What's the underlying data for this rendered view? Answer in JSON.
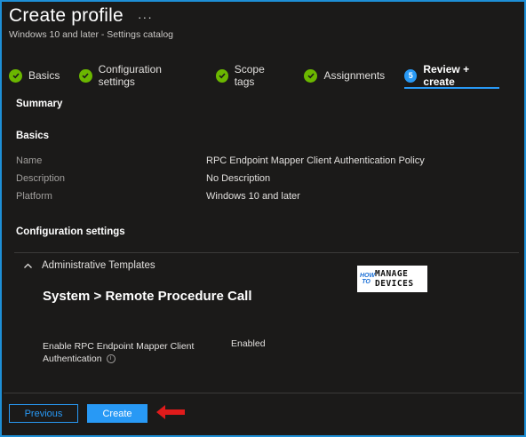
{
  "header": {
    "title": "Create profile",
    "more_label": "···",
    "subtitle": "Windows 10 and later - Settings catalog"
  },
  "steps": [
    {
      "label": "Basics",
      "state": "complete"
    },
    {
      "label": "Configuration settings",
      "state": "complete"
    },
    {
      "label": "Scope tags",
      "state": "complete"
    },
    {
      "label": "Assignments",
      "state": "complete"
    },
    {
      "label": "Review + create",
      "state": "active",
      "number": "5"
    }
  ],
  "summary": {
    "title": "Summary",
    "basics_title": "Basics",
    "rows": [
      {
        "key": "Name",
        "value": "RPC Endpoint Mapper Client Authentication Policy"
      },
      {
        "key": "Description",
        "value": "No Description"
      },
      {
        "key": "Platform",
        "value": "Windows 10 and later"
      }
    ],
    "config_title": "Configuration settings"
  },
  "config": {
    "group_label": "Administrative Templates",
    "category": "System > Remote Procedure Call",
    "setting_name": "Enable RPC Endpoint Mapper Client Authentication",
    "setting_value": "Enabled"
  },
  "logo": {
    "how_to": "HOW TO",
    "line1": "MANAGE",
    "line2": "DEVICES"
  },
  "footer": {
    "previous_label": "Previous",
    "create_label": "Create"
  },
  "colors": {
    "accent": "#2899f5",
    "success": "#6bb700",
    "annotation_arrow": "#e01b1b",
    "frame": "#1e8fd6"
  }
}
